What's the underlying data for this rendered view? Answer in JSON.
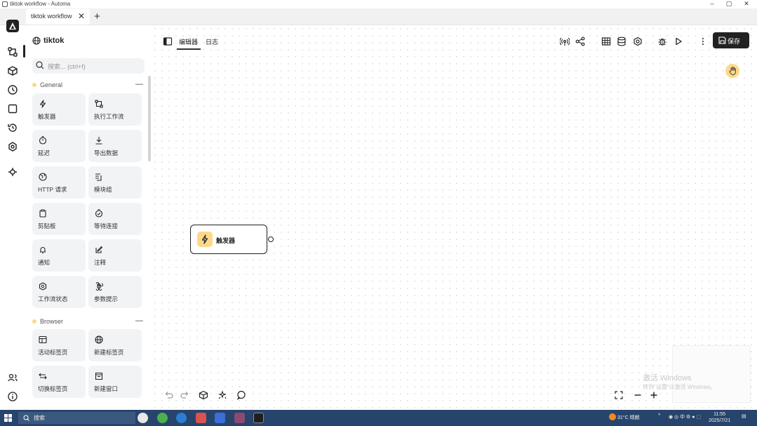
{
  "window": {
    "title": "tiktok workflow - Automa",
    "controls": [
      "–",
      "▢",
      "✕"
    ]
  },
  "tabs": [
    {
      "label": "tiktok workflow",
      "close": "✕"
    }
  ],
  "newtab_label": "+",
  "sidebar": {
    "workflow_name": "tiktok",
    "search_placeholder": "搜索... (ctrl+f)",
    "groups": [
      {
        "name": "General",
        "items": [
          {
            "label": "触发器",
            "icon": "bolt-icon"
          },
          {
            "label": "执行工作流",
            "icon": "workflow-icon"
          },
          {
            "label": "延迟",
            "icon": "timer-icon"
          },
          {
            "label": "导出数据",
            "icon": "download-icon"
          },
          {
            "label": "HTTP 请求",
            "icon": "globe-icon"
          },
          {
            "label": "模块组",
            "icon": "block-group-icon"
          },
          {
            "label": "剪贴板",
            "icon": "clipboard-icon"
          },
          {
            "label": "等待连接",
            "icon": "timer-check-icon"
          },
          {
            "label": "通知",
            "icon": "bell-icon"
          },
          {
            "label": "注释",
            "icon": "note-icon"
          },
          {
            "label": "工作流状态",
            "icon": "gear-icon"
          },
          {
            "label": "参数提示",
            "icon": "command-icon"
          }
        ]
      },
      {
        "name": "Browser",
        "items": [
          {
            "label": "活动标签页",
            "icon": "browser-tab-icon"
          },
          {
            "label": "新建标签页",
            "icon": "globe-icon"
          },
          {
            "label": "切换标签页",
            "icon": "swap-icon"
          },
          {
            "label": "新建窗口",
            "icon": "window-icon"
          }
        ]
      }
    ]
  },
  "toolbar": {
    "tab_editor": "编辑器",
    "tab_logs": "日志",
    "save_label": "保存"
  },
  "node": {
    "label": "触发器",
    "icon": "bolt-icon"
  },
  "watermark": {
    "line1": "激活 Windows",
    "line2": "转到\"设置\"以激活 Windows。"
  },
  "taskbar": {
    "search_text": "搜索",
    "weather": "31°C 晴朗",
    "tray_text": "中",
    "time": "11:55",
    "date": "2025/7/21"
  },
  "colors": {
    "accent": "#222222",
    "trigger_yellow": "#fcd98a",
    "card_bg": "#f2f3f5",
    "taskbar": "#27446c"
  }
}
